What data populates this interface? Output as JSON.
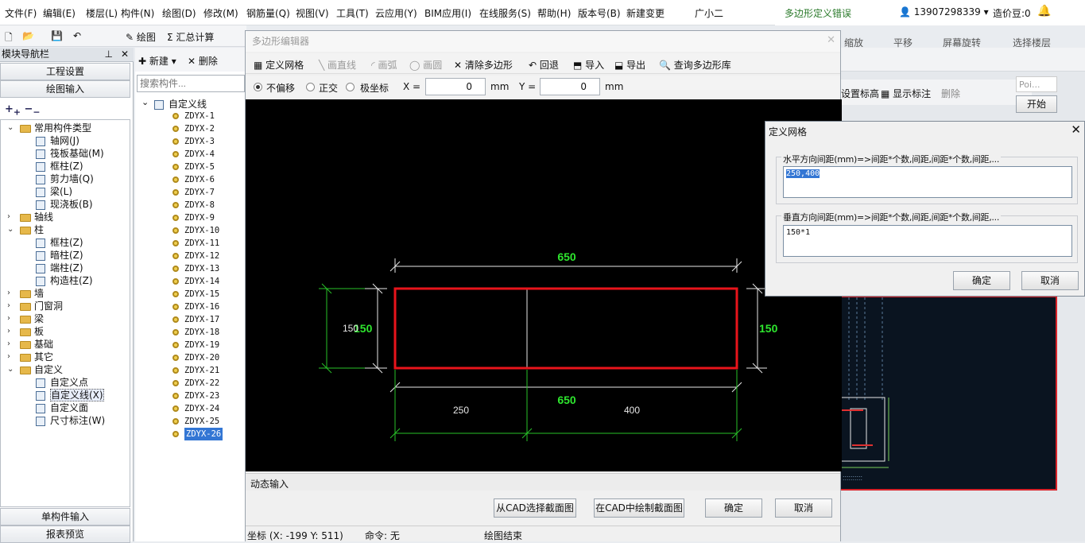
{
  "menu": [
    "文件(F)",
    "编辑(E)",
    "楼层(L)",
    "构件(N)",
    "绘图(D)",
    "修改(M)",
    "钢筋量(Q)",
    "视图(V)",
    "工具(T)",
    "云应用(Y)",
    "BIM应用(I)",
    "在线服务(S)",
    "帮助(H)",
    "版本号(B)",
    "新建变更",
    "广小二"
  ],
  "top_right": {
    "title": "多边形定义错误",
    "phone": "13907298339",
    "coins": "造价豆:0"
  },
  "toolbar": {
    "draw": "绘图",
    "sum": "汇总计算"
  },
  "right_toolbar": {
    "zoom": "缩放",
    "pan": "平移",
    "rotate": "屏幕旋转",
    "select_floor": "选择楼层",
    "set_elev": "设置标高",
    "show_dim": "显示标注",
    "delete": "删除",
    "poi": "Poi...",
    "start": "开始"
  },
  "nav": {
    "header": "模块导航栏",
    "btn_project": "工程设置",
    "btn_draw": "绘图输入",
    "btn_single": "单构件输入",
    "btn_report": "报表预览",
    "tree": [
      {
        "label": "常用构件类型",
        "level": 0,
        "type": "folder",
        "open": true
      },
      {
        "label": "轴网(J)",
        "level": 1,
        "type": "item"
      },
      {
        "label": "筏板基础(M)",
        "level": 1,
        "type": "item"
      },
      {
        "label": "框柱(Z)",
        "level": 1,
        "type": "item"
      },
      {
        "label": "剪力墙(Q)",
        "level": 1,
        "type": "item"
      },
      {
        "label": "梁(L)",
        "level": 1,
        "type": "item"
      },
      {
        "label": "现浇板(B)",
        "level": 1,
        "type": "item"
      },
      {
        "label": "轴线",
        "level": 0,
        "type": "folder",
        "open": false
      },
      {
        "label": "柱",
        "level": 0,
        "type": "folder",
        "open": true
      },
      {
        "label": "框柱(Z)",
        "level": 1,
        "type": "item"
      },
      {
        "label": "暗柱(Z)",
        "level": 1,
        "type": "item"
      },
      {
        "label": "端柱(Z)",
        "level": 1,
        "type": "item"
      },
      {
        "label": "构造柱(Z)",
        "level": 1,
        "type": "item"
      },
      {
        "label": "墙",
        "level": 0,
        "type": "folder",
        "open": false
      },
      {
        "label": "门窗洞",
        "level": 0,
        "type": "folder",
        "open": false
      },
      {
        "label": "梁",
        "level": 0,
        "type": "folder",
        "open": false
      },
      {
        "label": "板",
        "level": 0,
        "type": "folder",
        "open": false
      },
      {
        "label": "基础",
        "level": 0,
        "type": "folder",
        "open": false
      },
      {
        "label": "其它",
        "level": 0,
        "type": "folder",
        "open": false
      },
      {
        "label": "自定义",
        "level": 0,
        "type": "folder",
        "open": true
      },
      {
        "label": "自定义点",
        "level": 1,
        "type": "item"
      },
      {
        "label": "自定义线(X)",
        "level": 1,
        "type": "item",
        "selected": true
      },
      {
        "label": "自定义面",
        "level": 1,
        "type": "item"
      },
      {
        "label": "尺寸标注(W)",
        "level": 1,
        "type": "item"
      }
    ]
  },
  "components": {
    "new": "新建",
    "delete": "删除",
    "search_placeholder": "搜索构件...",
    "root": "自定义线",
    "items": [
      "ZDYX-1",
      "ZDYX-2",
      "ZDYX-3",
      "ZDYX-4",
      "ZDYX-5",
      "ZDYX-6",
      "ZDYX-7",
      "ZDYX-8",
      "ZDYX-9",
      "ZDYX-10",
      "ZDYX-11",
      "ZDYX-12",
      "ZDYX-13",
      "ZDYX-14",
      "ZDYX-15",
      "ZDYX-16",
      "ZDYX-17",
      "ZDYX-18",
      "ZDYX-19",
      "ZDYX-20",
      "ZDYX-21",
      "ZDYX-22",
      "ZDYX-23",
      "ZDYX-24",
      "ZDYX-25",
      "ZDYX-26"
    ],
    "selected": "ZDYX-26"
  },
  "editor": {
    "title": "多边形编辑器",
    "tools": {
      "define_grid": "定义网格",
      "draw_line": "画直线",
      "draw_arc": "画弧",
      "draw_circle": "画圆",
      "clear": "清除多边形",
      "undo": "回退",
      "import": "导入",
      "export": "导出",
      "query": "查询多边形库"
    },
    "modes": {
      "no_offset": "不偏移",
      "ortho": "正交",
      "polar": "极坐标"
    },
    "x_label": "X =",
    "x_value": "0",
    "y_label": "Y =",
    "y_value": "0",
    "unit": "mm",
    "canvas": {
      "width": "650",
      "height": "150",
      "seg1": "250",
      "seg2": "400",
      "width_bottom": "650",
      "height_left_small": "150",
      "height_right": "150"
    },
    "dynamic_input": "动态输入",
    "btn_cad_select": "从CAD选择截面图",
    "btn_cad_draw": "在CAD中绘制截面图",
    "btn_ok": "确定",
    "btn_cancel": "取消",
    "status": {
      "coord": "坐标 (X: -199 Y: 511)",
      "cmd": "命令: 无",
      "draw_end": "绘图结束"
    }
  },
  "grid_dialog": {
    "title": "定义网格",
    "h_label": "水平方向间距(mm)=>间距*个数,间距,间距*个数,间距,...",
    "h_value": "250,400",
    "v_label": "垂直方向间距(mm)=>间距*个数,间距,间距*个数,间距,...",
    "v_value": "150*1",
    "ok": "确定",
    "cancel": "取消"
  }
}
